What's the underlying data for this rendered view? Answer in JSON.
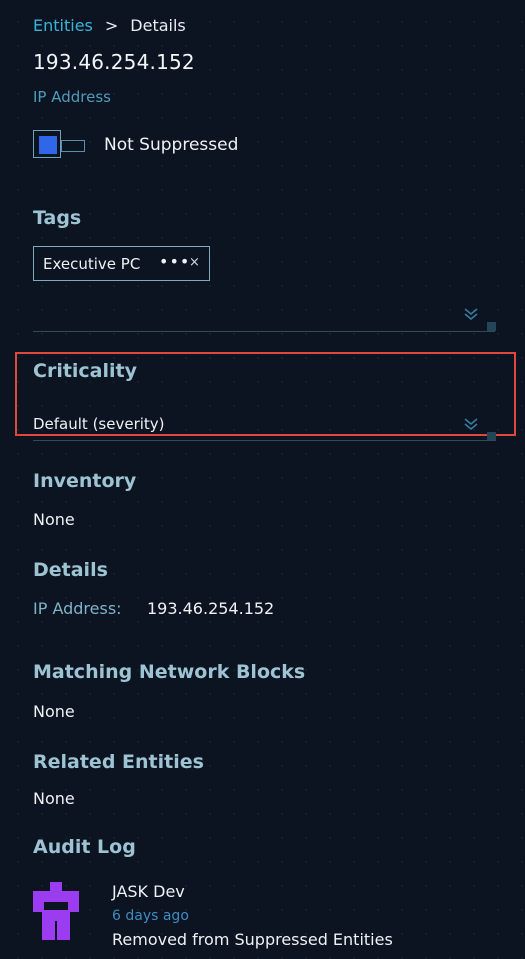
{
  "breadcrumb": {
    "link": "Entities",
    "separator": ">",
    "current": "Details"
  },
  "entity": {
    "title": "193.46.254.152",
    "type": "IP Address"
  },
  "suppression": {
    "label": "Not Suppressed",
    "toggle_color": "#2f67e8"
  },
  "tags": {
    "heading": "Tags",
    "items": [
      {
        "label": "Executive PC",
        "more": "•••",
        "remove": "×"
      }
    ]
  },
  "criticality": {
    "heading": "Criticality",
    "selected": "Default (severity)"
  },
  "inventory": {
    "heading": "Inventory",
    "value": "None"
  },
  "details": {
    "heading": "Details",
    "label": "IP Address:",
    "value": "193.46.254.152"
  },
  "matching_network_blocks": {
    "heading": "Matching Network Blocks",
    "value": "None"
  },
  "related_entities": {
    "heading": "Related Entities",
    "value": "None"
  },
  "audit_log": {
    "heading": "Audit Log",
    "entries": [
      {
        "user": "JASK Dev",
        "time": "6 days ago",
        "message": "Removed from Suppressed Entities",
        "avatar_color": "#9b3cf0"
      }
    ]
  },
  "colors": {
    "accent": "#3ab3da",
    "highlight": "#e0483d",
    "background": "#0b1420"
  }
}
